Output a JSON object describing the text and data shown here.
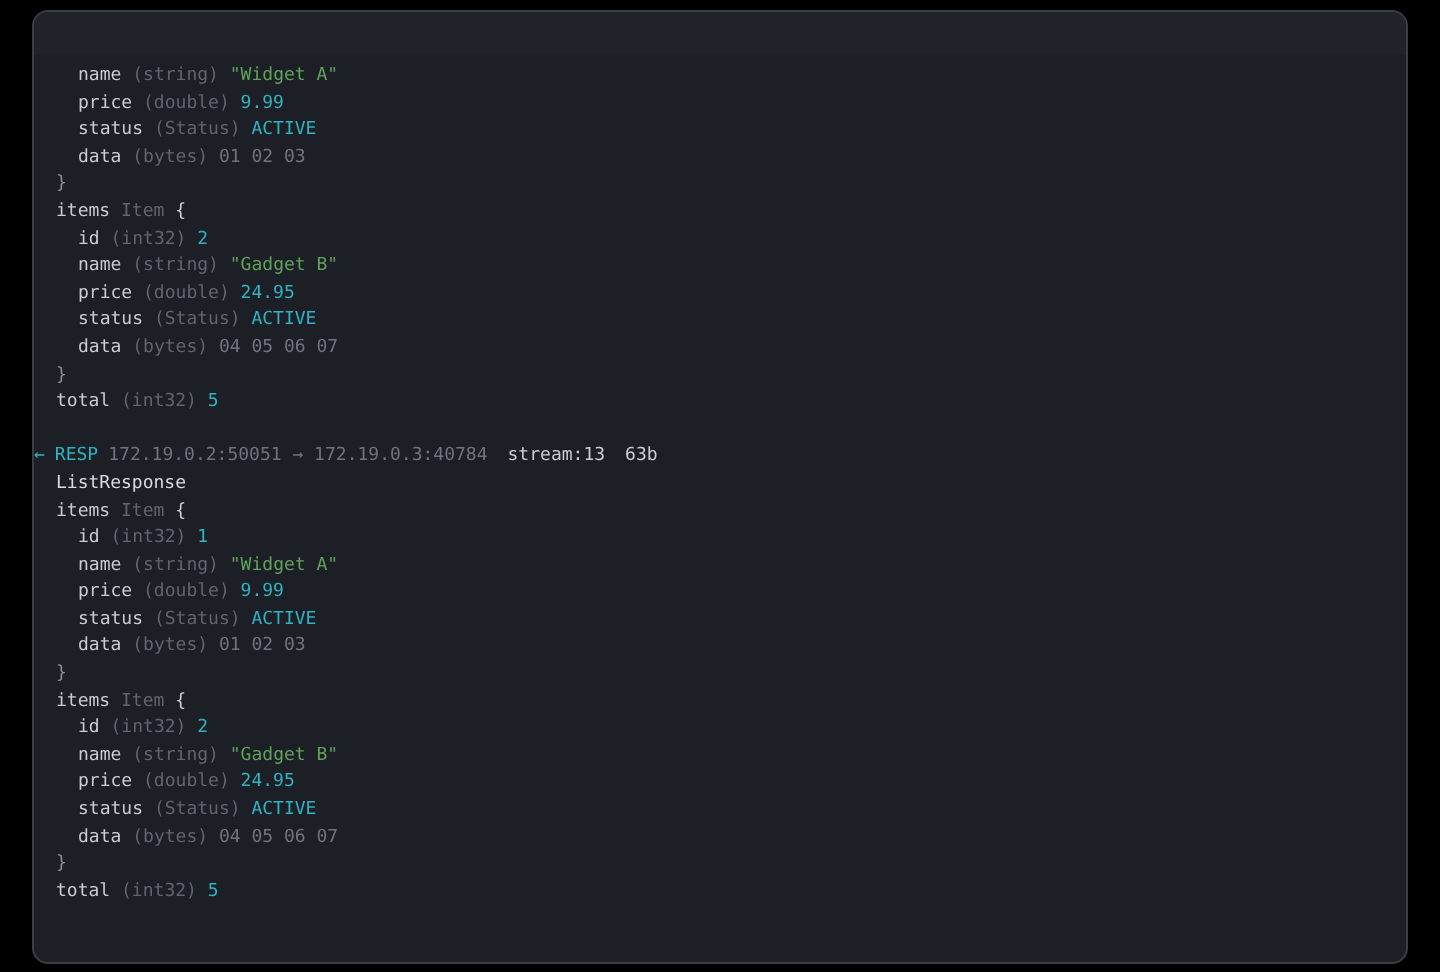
{
  "frames": [
    {
      "kind": "partial",
      "fields": [
        {
          "kind": "group",
          "close": "}",
          "children": [
            {
              "kind": "field",
              "name": "name",
              "type": "(string)",
              "value": "\"Widget A\"",
              "color": "#5fa35a"
            },
            {
              "kind": "field",
              "name": "price",
              "type": "(double)",
              "value": "9.99",
              "color": "#2fb3c2"
            },
            {
              "kind": "field",
              "name": "status",
              "type": "(Status)",
              "value": "ACTIVE",
              "color": "#2fb3c2"
            },
            {
              "kind": "field",
              "name": "data",
              "type": "(bytes)",
              "value": "01 02 03",
              "color": "#6f747c"
            }
          ]
        },
        {
          "kind": "group",
          "name": "items",
          "type": "Item",
          "open": "{",
          "close": "}",
          "children": [
            {
              "kind": "field",
              "name": "id",
              "type": "(int32)",
              "value": "2",
              "color": "#2fb3c2"
            },
            {
              "kind": "field",
              "name": "name",
              "type": "(string)",
              "value": "\"Gadget B\"",
              "color": "#5fa35a"
            },
            {
              "kind": "field",
              "name": "price",
              "type": "(double)",
              "value": "24.95",
              "color": "#2fb3c2"
            },
            {
              "kind": "field",
              "name": "status",
              "type": "(Status)",
              "value": "ACTIVE",
              "color": "#2fb3c2"
            },
            {
              "kind": "field",
              "name": "data",
              "type": "(bytes)",
              "value": "04 05 06 07",
              "color": "#6f747c"
            }
          ]
        },
        {
          "kind": "field",
          "name": "total",
          "type": "(int32)",
          "value": "5",
          "color": "#2fb3c2"
        }
      ]
    },
    {
      "kind": "resp",
      "arrow": "←",
      "label": "RESP",
      "route": "172.19.0.2:50051 → 172.19.0.3:40784",
      "stream": "stream:13",
      "size": "63b",
      "message": "ListResponse",
      "fields": [
        {
          "kind": "group",
          "name": "items",
          "type": "Item",
          "open": "{",
          "close": "}",
          "children": [
            {
              "kind": "field",
              "name": "id",
              "type": "(int32)",
              "value": "1",
              "color": "#2fb3c2"
            },
            {
              "kind": "field",
              "name": "name",
              "type": "(string)",
              "value": "\"Widget A\"",
              "color": "#5fa35a"
            },
            {
              "kind": "field",
              "name": "price",
              "type": "(double)",
              "value": "9.99",
              "color": "#2fb3c2"
            },
            {
              "kind": "field",
              "name": "status",
              "type": "(Status)",
              "value": "ACTIVE",
              "color": "#2fb3c2"
            },
            {
              "kind": "field",
              "name": "data",
              "type": "(bytes)",
              "value": "01 02 03",
              "color": "#6f747c"
            }
          ]
        },
        {
          "kind": "group",
          "name": "items",
          "type": "Item",
          "open": "{",
          "close": "}",
          "children": [
            {
              "kind": "field",
              "name": "id",
              "type": "(int32)",
              "value": "2",
              "color": "#2fb3c2"
            },
            {
              "kind": "field",
              "name": "name",
              "type": "(string)",
              "value": "\"Gadget B\"",
              "color": "#5fa35a"
            },
            {
              "kind": "field",
              "name": "price",
              "type": "(double)",
              "value": "24.95",
              "color": "#2fb3c2"
            },
            {
              "kind": "field",
              "name": "status",
              "type": "(Status)",
              "value": "ACTIVE",
              "color": "#2fb3c2"
            },
            {
              "kind": "field",
              "name": "data",
              "type": "(bytes)",
              "value": "04 05 06 07",
              "color": "#6f747c"
            }
          ]
        },
        {
          "kind": "field",
          "name": "total",
          "type": "(int32)",
          "value": "5",
          "color": "#2fb3c2"
        }
      ]
    }
  ]
}
